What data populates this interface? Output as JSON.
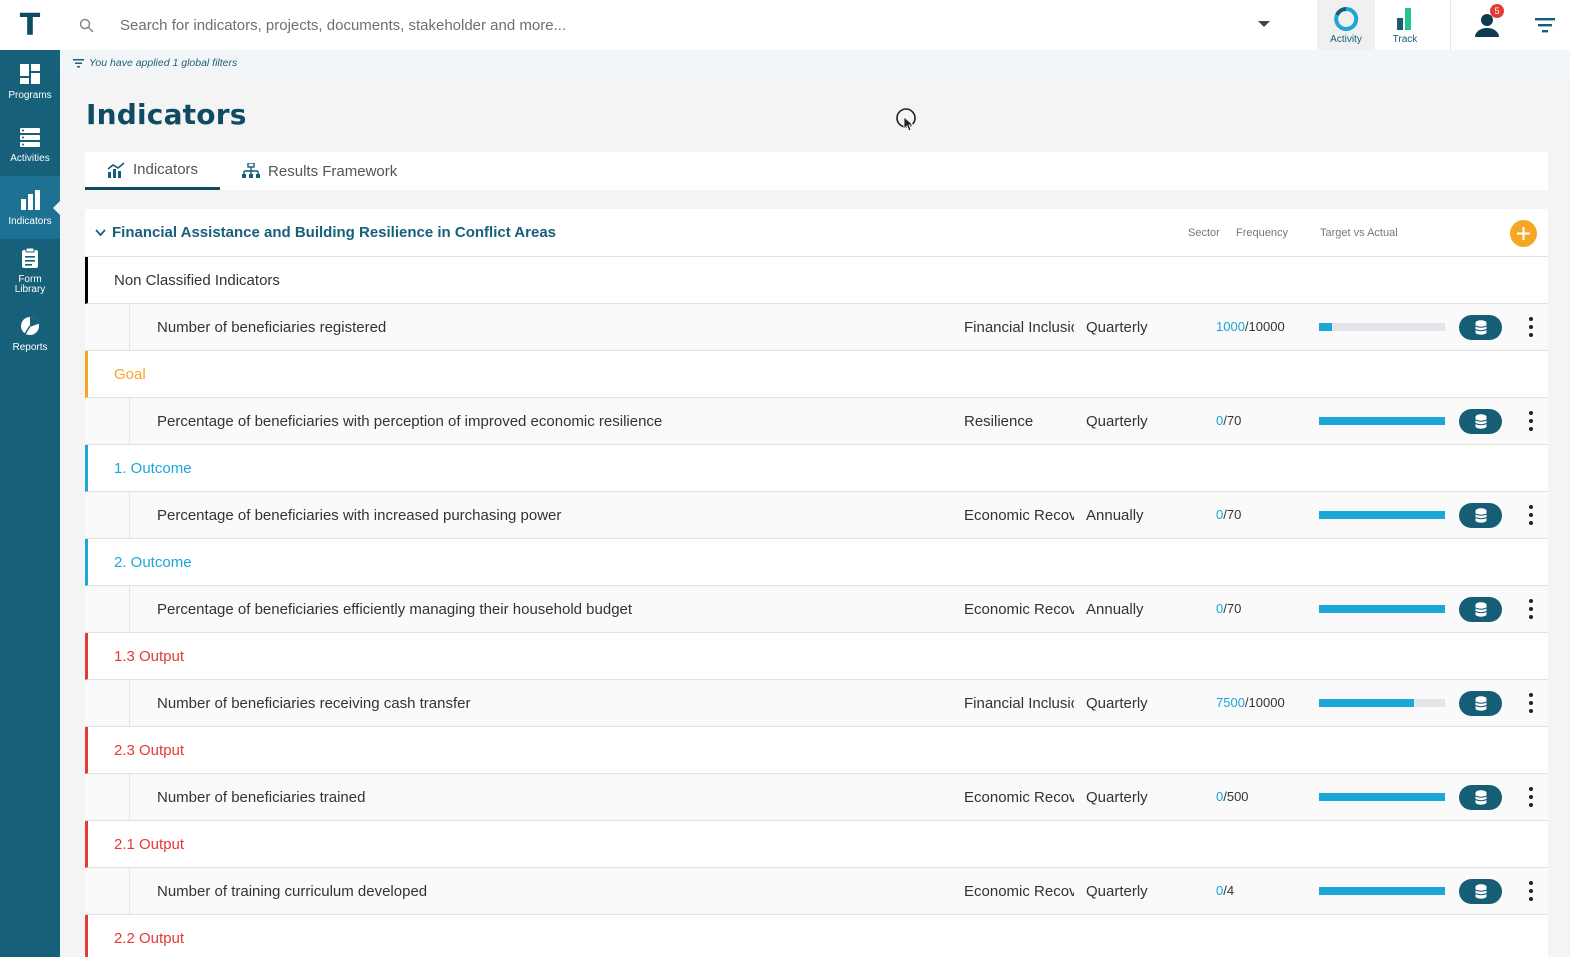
{
  "app": {
    "logo_letter": "T"
  },
  "rail": {
    "items": [
      {
        "label": "Programs",
        "icon": "dashboard-icon"
      },
      {
        "label": "Activities",
        "icon": "server-icon"
      },
      {
        "label": "Indicators",
        "icon": "bar-chart-icon",
        "active": true
      },
      {
        "label_line1": "Form",
        "label_line2": "Library",
        "icon": "clipboard-icon"
      },
      {
        "label": "Reports",
        "icon": "pie-chart-icon"
      }
    ]
  },
  "topbar": {
    "search_placeholder": "Search for indicators, projects, documents, stakeholder and more...",
    "activity_label": "Activity",
    "track_label": "Track",
    "notification_count": "5"
  },
  "filter_notice": "You have applied 1 global filters",
  "page_title": "Indicators",
  "tabs": [
    {
      "label": "Indicators",
      "active": true
    },
    {
      "label": "Results Framework",
      "active": false
    }
  ],
  "program": {
    "title": "Financial Assistance and Building Resilience in Conflict Areas",
    "col_sector": "Sector",
    "col_frequency": "Frequency",
    "col_target": "Target vs Actual"
  },
  "colors": {
    "brand": "#16607a",
    "accent": "#1ba7d8",
    "goal": "#f5a623",
    "outcome": "#1ba7d8",
    "output": "#e53935",
    "add_button": "#f5a623"
  },
  "groups": [
    {
      "label": "Non Classified Indicators",
      "color": "#000000",
      "text_color": "#333333",
      "indicator": {
        "name": "Number of beneficiaries registered",
        "sector": "Financial Inclusion",
        "frequency": "Quarterly",
        "actual": "1000",
        "target": "/10000",
        "progress": 0.1
      }
    },
    {
      "label": "Goal",
      "color": "#f5a623",
      "text_color": "#f5a623",
      "indicator": {
        "name": "Percentage of beneficiaries with perception of improved economic resilience",
        "sector": "Resilience",
        "frequency": "Quarterly",
        "actual": "0",
        "target": "/70",
        "progress": 1
      }
    },
    {
      "label": "1. Outcome",
      "color": "#1ba7d8",
      "text_color": "#1ba7d8",
      "indicator": {
        "name": "Percentage of beneficiaries with increased purchasing power",
        "sector": "Economic Recovery",
        "frequency": "Annually",
        "actual": "0",
        "target": "/70",
        "progress": 1
      }
    },
    {
      "label": "2. Outcome",
      "color": "#1ba7d8",
      "text_color": "#1ba7d8",
      "indicator": {
        "name": "Percentage of beneficiaries efficiently managing their household budget",
        "sector": "Economic Recovery",
        "frequency": "Annually",
        "actual": "0",
        "target": "/70",
        "progress": 1
      }
    },
    {
      "label": "1.3 Output",
      "color": "#e53935",
      "text_color": "#e53935",
      "indicator": {
        "name": "Number of beneficiaries receiving cash transfer",
        "sector": "Financial Inclusion",
        "frequency": "Quarterly",
        "actual": "7500",
        "target": "/10000",
        "progress": 0.75
      }
    },
    {
      "label": "2.3 Output",
      "color": "#e53935",
      "text_color": "#e53935",
      "indicator": {
        "name": "Number of beneficiaries trained",
        "sector": "Economic Recovery",
        "frequency": "Quarterly",
        "actual": "0",
        "target": "/500",
        "progress": 1
      }
    },
    {
      "label": "2.1 Output",
      "color": "#e53935",
      "text_color": "#e53935",
      "indicator": {
        "name": "Number of training curriculum developed",
        "sector": "Economic Recovery",
        "frequency": "Quarterly",
        "actual": "0",
        "target": "/4",
        "progress": 1
      }
    },
    {
      "label": "2.2 Output",
      "color": "#e53935",
      "text_color": "#e53935"
    }
  ]
}
